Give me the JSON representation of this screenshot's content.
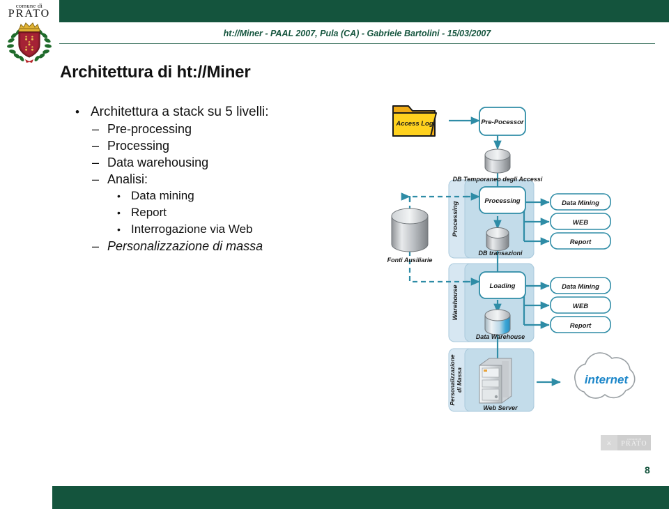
{
  "header": {
    "bar_color": "#14543d",
    "text": "ht://Miner - PAAL 2007, Pula (CA) - Gabriele Bartolini - 15/03/2007"
  },
  "logo": {
    "line1": "comune di",
    "line2": "PRATO",
    "arms_alt": "coat-of-arms"
  },
  "title": "Architettura di ht://Miner",
  "bullets": [
    {
      "level": 1,
      "marker": "•",
      "text": "Architettura a stack su 5 livelli:",
      "italic": false
    },
    {
      "level": 2,
      "marker": "–",
      "text": "Pre-processing",
      "italic": false
    },
    {
      "level": 2,
      "marker": "–",
      "text": "Processing",
      "italic": false
    },
    {
      "level": 2,
      "marker": "–",
      "text": "Data warehousing",
      "italic": false
    },
    {
      "level": 2,
      "marker": "–",
      "text": "Analisi:",
      "italic": false
    },
    {
      "level": 3,
      "marker": "•",
      "text": "Data mining",
      "italic": false
    },
    {
      "level": 3,
      "marker": "•",
      "text": "Report",
      "italic": false
    },
    {
      "level": 3,
      "marker": "•",
      "text": "Interrogazione via Web",
      "italic": false
    },
    {
      "level": 2,
      "marker": "–",
      "text": "Personalizzazione di massa",
      "italic": true
    }
  ],
  "diagram": {
    "accent": "#2e8ca6",
    "group_fill": "#d7e7f2",
    "band_fill": "#c3dcea",
    "box_border": "#2e8ca6",
    "folder_fill": "#ffd21f",
    "nodes": {
      "access_log": "Access Log",
      "pre_processor": "Pre-Pocessor",
      "db_temp": "DB Temporaneo degli Accessi",
      "fonti": "Fonti Ausiliarie",
      "processing_band": "Processing",
      "processing_box": "Processing",
      "db_transazioni": "DB transazioni",
      "warehouse_band": "Warehouse",
      "loading_box": "Loading",
      "data_warehouse": "Data Warehouse",
      "personalizzazione_band_1": "Personalizzazione",
      "personalizzazione_band_2": "di Massa",
      "web_server": "Web Server",
      "internet": "internet"
    },
    "outputs_top": [
      "Data Mining",
      "WEB",
      "Report"
    ],
    "outputs_bottom": [
      "Data Mining",
      "WEB",
      "Report"
    ]
  },
  "footer": {
    "bar_color": "#14543d",
    "page_number": "8",
    "logo_line1": "comune di",
    "logo_line2": "PRATO"
  }
}
